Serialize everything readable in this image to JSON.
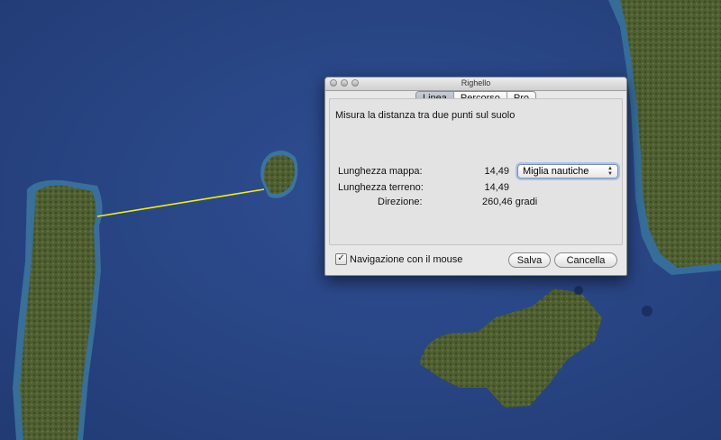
{
  "window": {
    "title": "Righello"
  },
  "tabs": [
    {
      "label": "Linea",
      "active": true
    },
    {
      "label": "Percorso",
      "active": false
    },
    {
      "label": "Pro",
      "active": false
    }
  ],
  "measure": {
    "description": "Misura la distanza tra due punti sul suolo",
    "map_length_label": "Lunghezza mappa:",
    "map_length_value": "14,49",
    "unit_selected": "Miglia nautiche",
    "ground_length_label": "Lunghezza terreno:",
    "ground_length_value": "14,49",
    "direction_label": "Direzione:",
    "direction_value": "260,46 gradi"
  },
  "footer": {
    "mouse_nav_label": "Navigazione con il mouse",
    "mouse_nav_checked": true,
    "save_label": "Salva",
    "cancel_label": "Cancella"
  },
  "colors": {
    "ocean": "#2b4a8c",
    "land": "#4a5a2e",
    "ruler_line": "#f2f200",
    "tab_active": "#b4bdcb"
  }
}
